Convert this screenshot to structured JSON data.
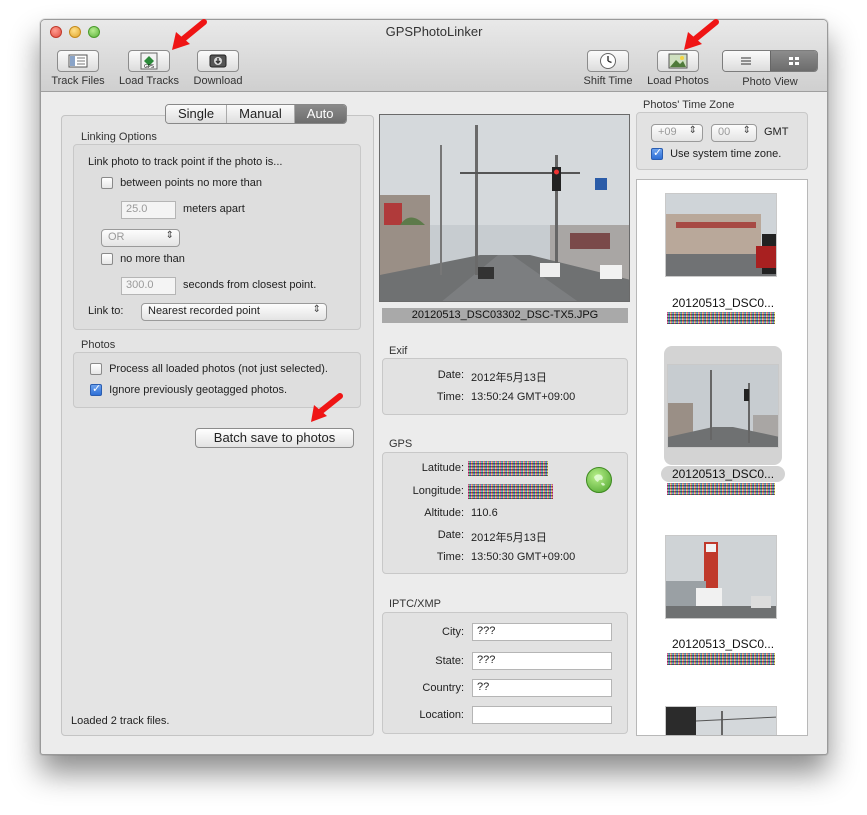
{
  "window": {
    "title": "GPSPhotoLinker"
  },
  "toolbar": {
    "track_files": "Track Files",
    "load_tracks": "Load Tracks",
    "download": "Download",
    "shift_time": "Shift Time",
    "load_photos": "Load Photos",
    "photo_view": "Photo View",
    "gps_icon_text": "GPS"
  },
  "mode": {
    "tabs": [
      "Single",
      "Manual",
      "Auto"
    ],
    "selected": "Auto"
  },
  "linking": {
    "title": "Linking Options",
    "intro": "Link photo to track point if the photo is...",
    "between_label": "between points no more than",
    "between_checked": false,
    "meters_value": "25.0",
    "meters_label": "meters apart",
    "operator": "OR",
    "no_more_label": "no more than",
    "no_more_checked": false,
    "seconds_value": "300.0",
    "seconds_label": "seconds from closest point.",
    "link_to_label": "Link to:",
    "link_to_value": "Nearest recorded point"
  },
  "photos": {
    "title": "Photos",
    "process_all_label": "Process all loaded photos (not just selected).",
    "process_all_checked": false,
    "ignore_label": "Ignore previously geotagged photos.",
    "ignore_checked": true
  },
  "batch_button": "Batch save to photos",
  "status": "Loaded 2 track files.",
  "current_photo": {
    "filename": "20120513_DSC03302_DSC-TX5.JPG"
  },
  "exif": {
    "title": "Exif",
    "date_label": "Date:",
    "date_value": "2012年5月13日",
    "time_label": "Time:",
    "time_value": "13:50:24 GMT+09:00"
  },
  "gps": {
    "title": "GPS",
    "latitude_label": "Latitude:",
    "longitude_label": "Longitude:",
    "altitude_label": "Altitude:",
    "altitude_value": "110.6",
    "date_label": "Date:",
    "date_value": "2012年5月13日",
    "time_label": "Time:",
    "time_value": "13:50:30 GMT+09:00"
  },
  "iptc": {
    "title": "IPTC/XMP",
    "city_label": "City:",
    "city_value": "???",
    "state_label": "State:",
    "state_value": "???",
    "country_label": "Country:",
    "country_value": "??",
    "location_label": "Location:",
    "location_value": ""
  },
  "timezone": {
    "title": "Photos' Time Zone",
    "hours": "+09",
    "minutes": "00",
    "gmt_label": "GMT",
    "use_system_label": "Use system time zone.",
    "use_system_checked": true
  },
  "thumbnails": [
    {
      "name": "20120513_DSC0..."
    },
    {
      "name": "20120513_DSC0..."
    },
    {
      "name": "20120513_DSC0..."
    }
  ],
  "colors": {
    "arrow": "#ef1515",
    "selection": "#d3d3d3",
    "accent": "#2e6fd6"
  }
}
